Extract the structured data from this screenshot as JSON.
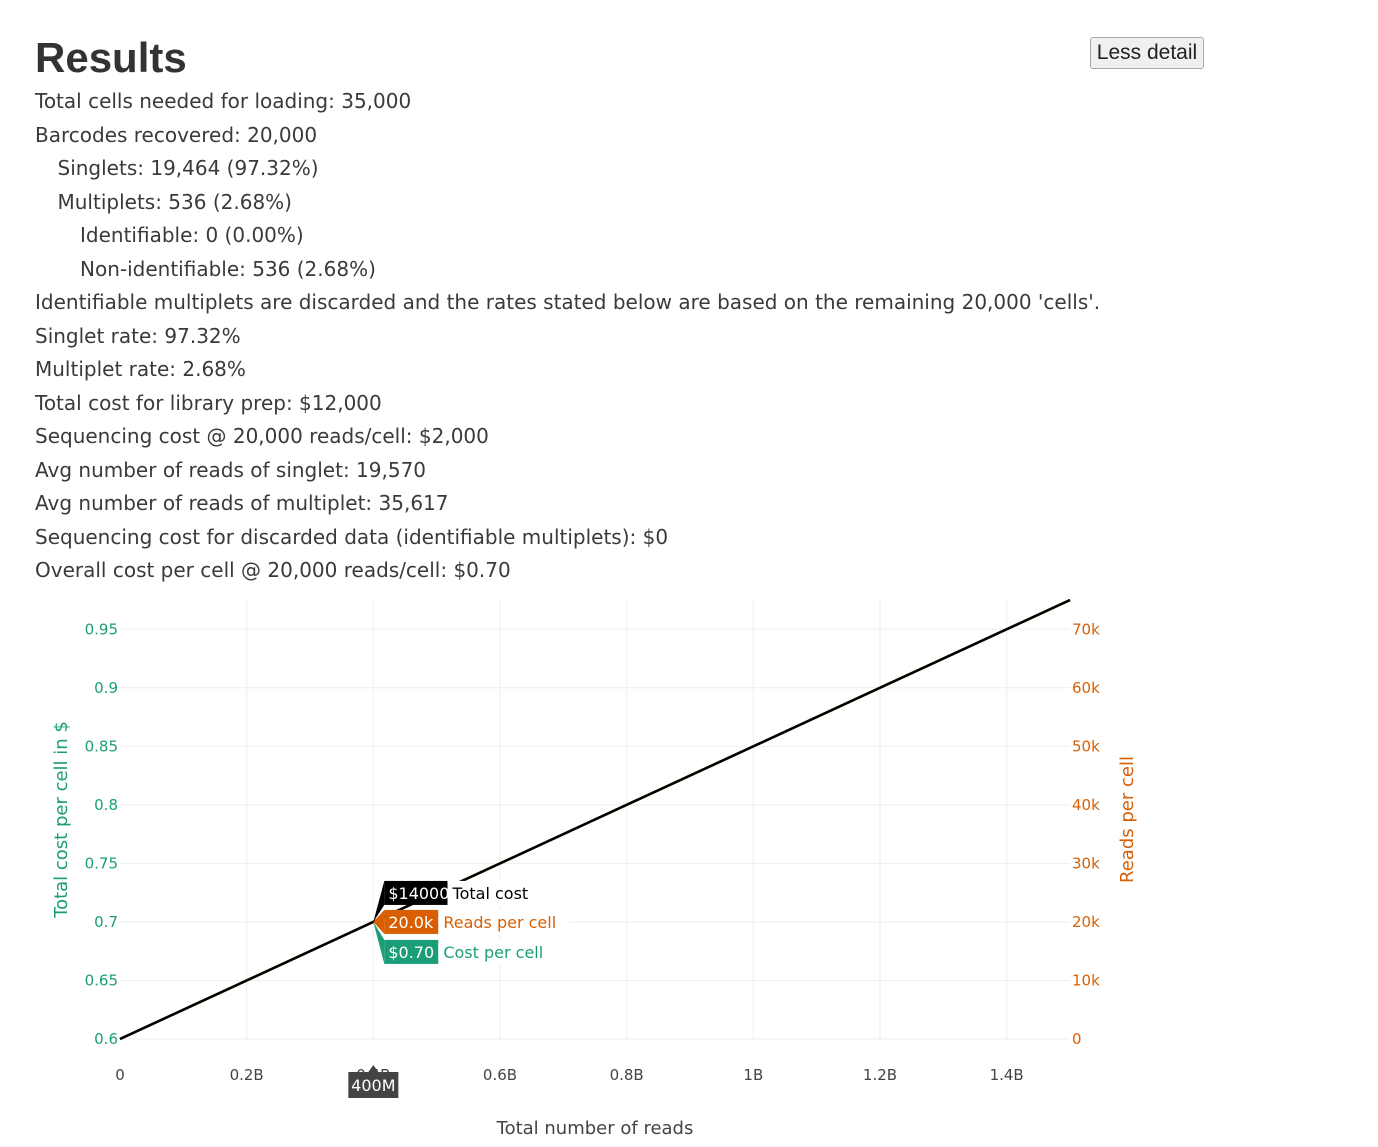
{
  "page": {
    "title": "Results",
    "toggle_button_label": "Less detail"
  },
  "stats": [
    {
      "text": "Total cells needed for loading: 35,000",
      "indent": 0
    },
    {
      "text": "Barcodes recovered: 20,000",
      "indent": 0
    },
    {
      "text": "Singlets: 19,464 (97.32%)",
      "indent": 1
    },
    {
      "text": "Multiplets: 536 (2.68%)",
      "indent": 1
    },
    {
      "text": "Identifiable: 0 (0.00%)",
      "indent": 2
    },
    {
      "text": "Non-identifiable: 536 (2.68%)",
      "indent": 2
    },
    {
      "text": "Identifiable multiplets are discarded and the rates stated below are based on the remaining 20,000 'cells'.",
      "indent": 0
    },
    {
      "text": "Singlet rate: 97.32%",
      "indent": 0
    },
    {
      "text": "Multiplet rate: 2.68%",
      "indent": 0
    },
    {
      "text": "Total cost for library prep: $12,000",
      "indent": 0
    },
    {
      "text": "Sequencing cost @ 20,000 reads/cell: $2,000",
      "indent": 0
    },
    {
      "text": "Avg number of reads of singlet: 19,570",
      "indent": 0
    },
    {
      "text": "Avg number of reads of multiplet: 35,617",
      "indent": 0
    },
    {
      "text": "Sequencing cost for discarded data (identifiable multiplets): $0",
      "indent": 0
    },
    {
      "text": "Overall cost per cell @ 20,000 reads/cell: $0.70",
      "indent": 0
    }
  ],
  "chart_data": {
    "type": "line",
    "xlabel": "Total number of reads",
    "ylabel_left": "Total cost per cell in $",
    "ylabel_right": "Reads per cell",
    "x_ticks": [
      {
        "value": 0,
        "label": "0"
      },
      {
        "value": 200000000,
        "label": "0.2B"
      },
      {
        "value": 400000000,
        "label": "0.4B"
      },
      {
        "value": 600000000,
        "label": "0.6B"
      },
      {
        "value": 800000000,
        "label": "0.8B"
      },
      {
        "value": 1000000000,
        "label": "1B"
      },
      {
        "value": 1200000000,
        "label": "1.2B"
      },
      {
        "value": 1400000000,
        "label": "1.4B"
      }
    ],
    "xlim": [
      0,
      1500000000
    ],
    "y_left_ticks": [
      {
        "value": 0.6,
        "label": "0.6"
      },
      {
        "value": 0.65,
        "label": "0.65"
      },
      {
        "value": 0.7,
        "label": "0.7"
      },
      {
        "value": 0.75,
        "label": "0.75"
      },
      {
        "value": 0.8,
        "label": "0.8"
      },
      {
        "value": 0.85,
        "label": "0.85"
      },
      {
        "value": 0.9,
        "label": "0.9"
      },
      {
        "value": 0.95,
        "label": "0.95"
      }
    ],
    "ylim_left": [
      0.6,
      0.975
    ],
    "y_right_ticks": [
      {
        "value": 0,
        "label": "0"
      },
      {
        "value": 10000,
        "label": "10k"
      },
      {
        "value": 20000,
        "label": "20k"
      },
      {
        "value": 30000,
        "label": "30k"
      },
      {
        "value": 40000,
        "label": "40k"
      },
      {
        "value": 50000,
        "label": "50k"
      },
      {
        "value": 60000,
        "label": "60k"
      },
      {
        "value": 70000,
        "label": "70k"
      }
    ],
    "ylim_right": [
      0,
      75000
    ],
    "series": [
      {
        "name": "Cost per cell",
        "axis": "left",
        "color": "#1b9e77",
        "x": [
          0,
          1500000000
        ],
        "y": [
          0.6,
          0.975
        ]
      },
      {
        "name": "Reads per cell",
        "axis": "right",
        "color": "#d95f02",
        "x": [
          0,
          1500000000
        ],
        "y": [
          0,
          75000
        ]
      },
      {
        "name": "Total cost",
        "axis": "left",
        "color": "#000000",
        "x": [
          0,
          1500000000
        ],
        "y": [
          0.6,
          0.975
        ]
      }
    ],
    "hover": {
      "x": 400000000,
      "x_label": "400M",
      "items": [
        {
          "value": "$14000",
          "name": "Total cost",
          "bg": "#000000",
          "fg": "#000000"
        },
        {
          "value": "20.0k",
          "name": "Reads per cell",
          "bg": "#d95f02",
          "fg": "#d95f02"
        },
        {
          "value": "$0.70",
          "name": "Cost per cell",
          "bg": "#1b9e77",
          "fg": "#1b9e77"
        }
      ]
    },
    "colors": {
      "left_axis": "#1b9e77",
      "right_axis": "#d95f02",
      "x_axis": "#444444",
      "grid": "#eeeeee",
      "spike_label_bg": "#444444"
    }
  }
}
